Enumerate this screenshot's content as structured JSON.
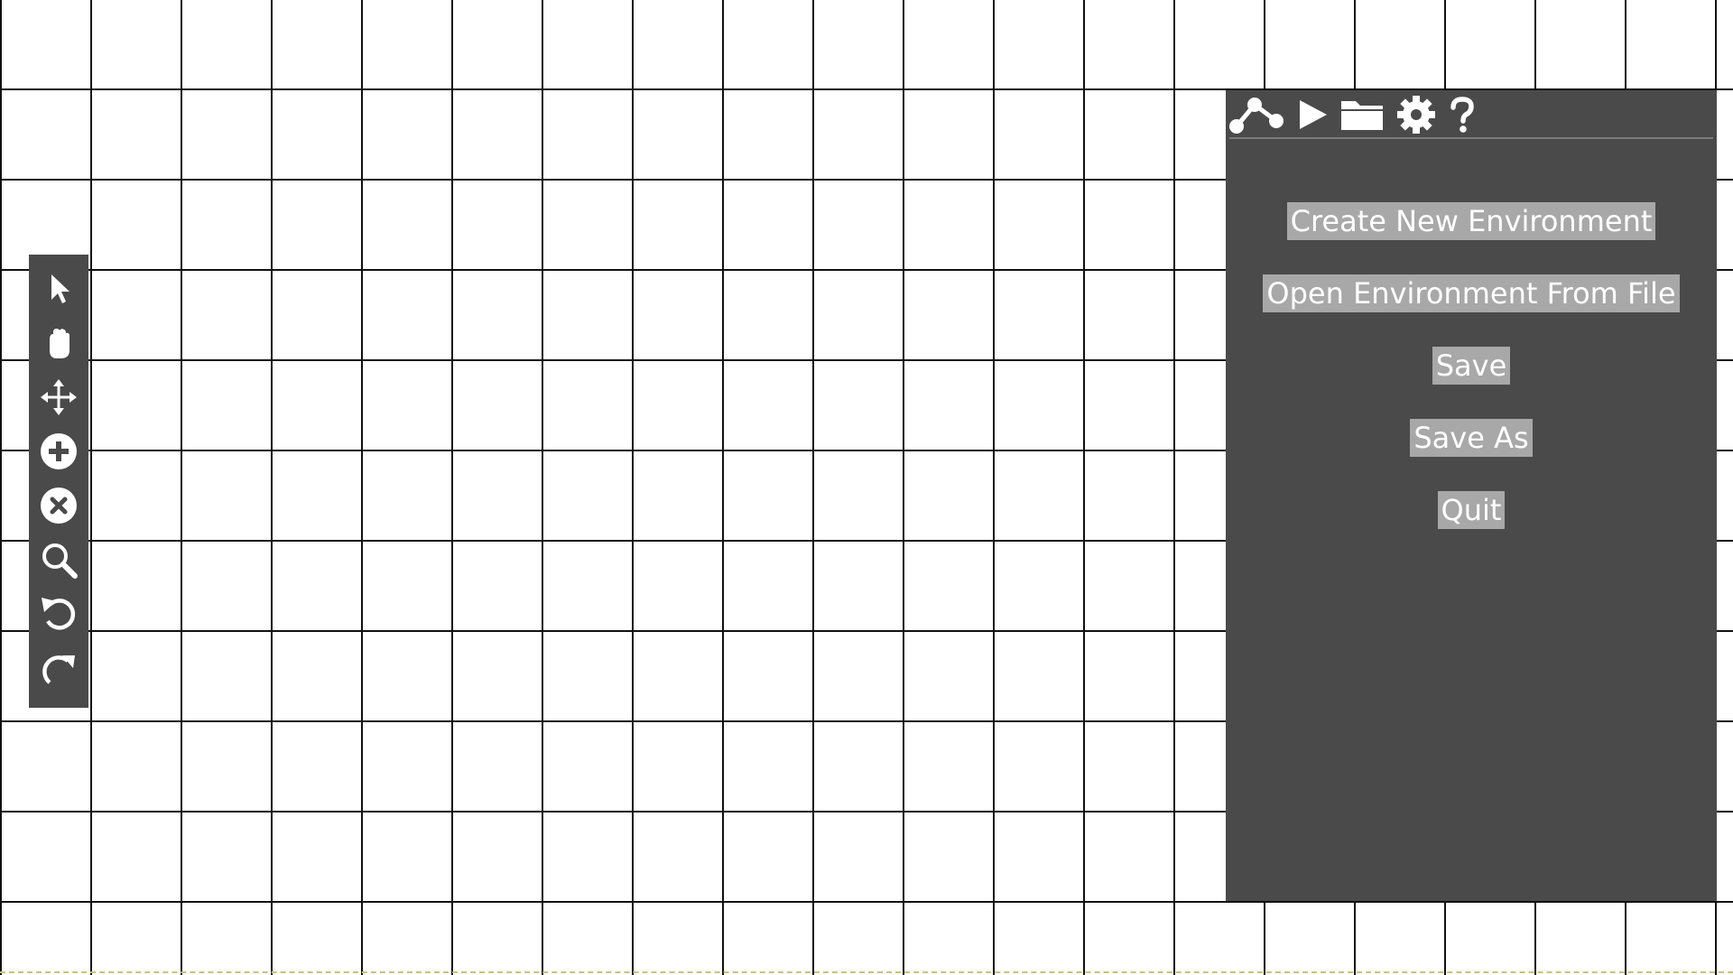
{
  "colors": {
    "panel_bg": "#4a4a4a",
    "button_bg": "#a8a8a8",
    "text": "#ffffff",
    "grid_line": "#111111"
  },
  "toolbar": {
    "tools": [
      {
        "icon": "pointer-icon"
      },
      {
        "icon": "hand-icon"
      },
      {
        "icon": "move-icon"
      },
      {
        "icon": "add-circle-icon"
      },
      {
        "icon": "remove-circle-icon"
      },
      {
        "icon": "zoom-icon"
      },
      {
        "icon": "undo-icon"
      },
      {
        "icon": "redo-icon"
      }
    ]
  },
  "panel": {
    "tabs": [
      {
        "icon": "graph-icon"
      },
      {
        "icon": "play-icon"
      },
      {
        "icon": "folder-icon"
      },
      {
        "icon": "gear-icon"
      },
      {
        "icon": "help-icon"
      }
    ],
    "menu": {
      "create_new": "Create New Environment",
      "open_file": "Open Environment From File",
      "save": "Save",
      "save_as": "Save As",
      "quit": "Quit"
    }
  }
}
